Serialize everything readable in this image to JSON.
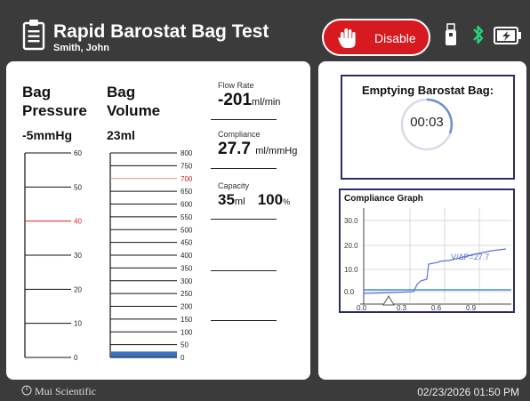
{
  "header": {
    "title": "Rapid Barostat Bag Test",
    "patient_name": "Smith, John",
    "disable_label": "Disable",
    "colors": {
      "disable": "#d71920",
      "bluetooth": "#27d07a"
    }
  },
  "pressure": {
    "label_line1": "Bag",
    "label_line2": "Pressure",
    "value": "-5mmHg",
    "scale_ticks": [
      "60",
      "50",
      "40",
      "30",
      "20",
      "10",
      "0"
    ],
    "highlight_tick": "40",
    "highlight_color": "#e02020"
  },
  "volume": {
    "label_line1": "Bag",
    "label_line2": "Volume",
    "value": "23ml",
    "scale_ticks": [
      "800",
      "750",
      "700",
      "650",
      "600",
      "550",
      "500",
      "450",
      "400",
      "350",
      "300",
      "250",
      "200",
      "150",
      "100",
      "50",
      "0"
    ],
    "highlight_tick": "700",
    "fill_ml": 23,
    "fill_color": "#3a6fc4"
  },
  "readouts": {
    "flow_rate": {
      "title": "Flow Rate",
      "value": "-201",
      "unit": "ml/min"
    },
    "compliance": {
      "title": "Compliance",
      "value": "27.7",
      "unit": "ml/mmHg"
    },
    "capacity": {
      "title": "Capacity",
      "value": "35",
      "unit": "ml",
      "percent": "100",
      "percent_unit": "%"
    }
  },
  "emptying": {
    "title": "Emptying Barostat Bag:",
    "timer": "00:03"
  },
  "graph": {
    "title": "Compliance Graph",
    "y_ticks": [
      "30.0",
      "20.0",
      "10.0",
      "0.0"
    ],
    "x_ticks": [
      "0.0",
      "0.3",
      "0.6",
      "0.9"
    ],
    "annotation": "V/ΔP=27.7"
  },
  "footer": {
    "logo_text": "Mui Scientific",
    "datetime": "02/23/2026 01:50 PM"
  },
  "icons": [
    "clipboard-icon",
    "hand-stop-icon",
    "usb-icon",
    "bluetooth-icon",
    "battery-charging-icon",
    "power-icon",
    "triangle-marker-icon"
  ]
}
